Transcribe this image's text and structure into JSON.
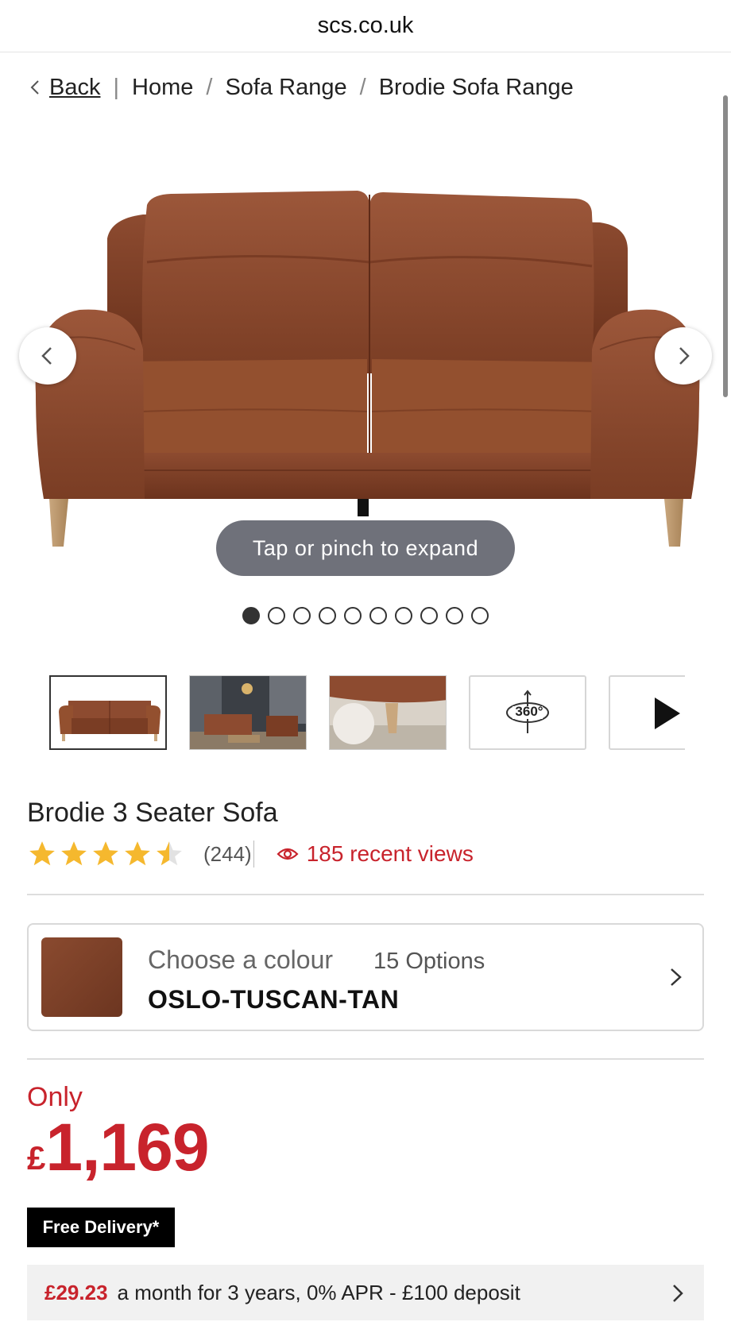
{
  "browser": {
    "url": "scs.co.uk"
  },
  "breadcrumb": {
    "back": "Back",
    "divider": "|",
    "separator": "/",
    "items": [
      "Home",
      "Sofa Range",
      "Brodie Sofa Range"
    ]
  },
  "gallery": {
    "expand_hint": "Tap or pinch to expand",
    "dots_total": 10,
    "dots_active_index": 0,
    "thumb_360_label": "360°",
    "icons": {
      "prev": "chevron-left-icon",
      "next": "chevron-right-icon",
      "rotate": "rotate-360-icon",
      "video": "play-icon"
    }
  },
  "product": {
    "title": "Brodie 3 Seater Sofa",
    "rating": 4.5,
    "review_count": "(244)",
    "recent_views": "185 recent views"
  },
  "colour": {
    "label": "Choose a colour",
    "options": "15 Options",
    "selected": "OSLO-TUSCAN-TAN",
    "swatch_color": "#7a3f27"
  },
  "price": {
    "prefix": "Only",
    "currency": "£",
    "amount": "1,169"
  },
  "delivery": {
    "badge": "Free Delivery*"
  },
  "finance": {
    "monthly": "£29.23",
    "text": "a month for 3 years, 0% APR - £100 deposit"
  },
  "colors": {
    "accent_red": "#c8232c",
    "star_gold": "#f5b82e",
    "leather": "#8a4a2f"
  }
}
